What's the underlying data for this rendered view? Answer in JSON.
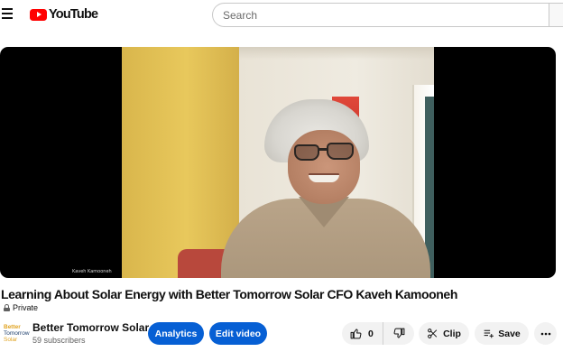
{
  "header": {
    "logo_text": "YouTube",
    "search_placeholder": "Search",
    "icons": {
      "menu": "hamburger-menu-icon",
      "logo": "youtube-play-icon"
    }
  },
  "video": {
    "overlay_tag": "Kaveh Kamooneh",
    "title": "Learning About Solar Energy with Better Tomorrow Solar CFO Kaveh Kamooneh",
    "privacy": "Private"
  },
  "channel": {
    "avatar_line1": "Better",
    "avatar_line2": "Tomorrow",
    "avatar_line3": "Solar",
    "name": "Better Tomorrow Solar",
    "subscribers": "59 subscribers"
  },
  "actions": {
    "analytics": "Analytics",
    "edit_video": "Edit video",
    "like_count": "0",
    "clip": "Clip",
    "save": "Save",
    "icons": [
      "thumbs-up-icon",
      "thumbs-down-icon",
      "scissors-icon",
      "playlist-add-icon",
      "more-icon"
    ]
  },
  "colors": {
    "brand_red": "#ff0000",
    "accent_blue": "#065fd4",
    "chip_gray": "#f2f2f2"
  }
}
